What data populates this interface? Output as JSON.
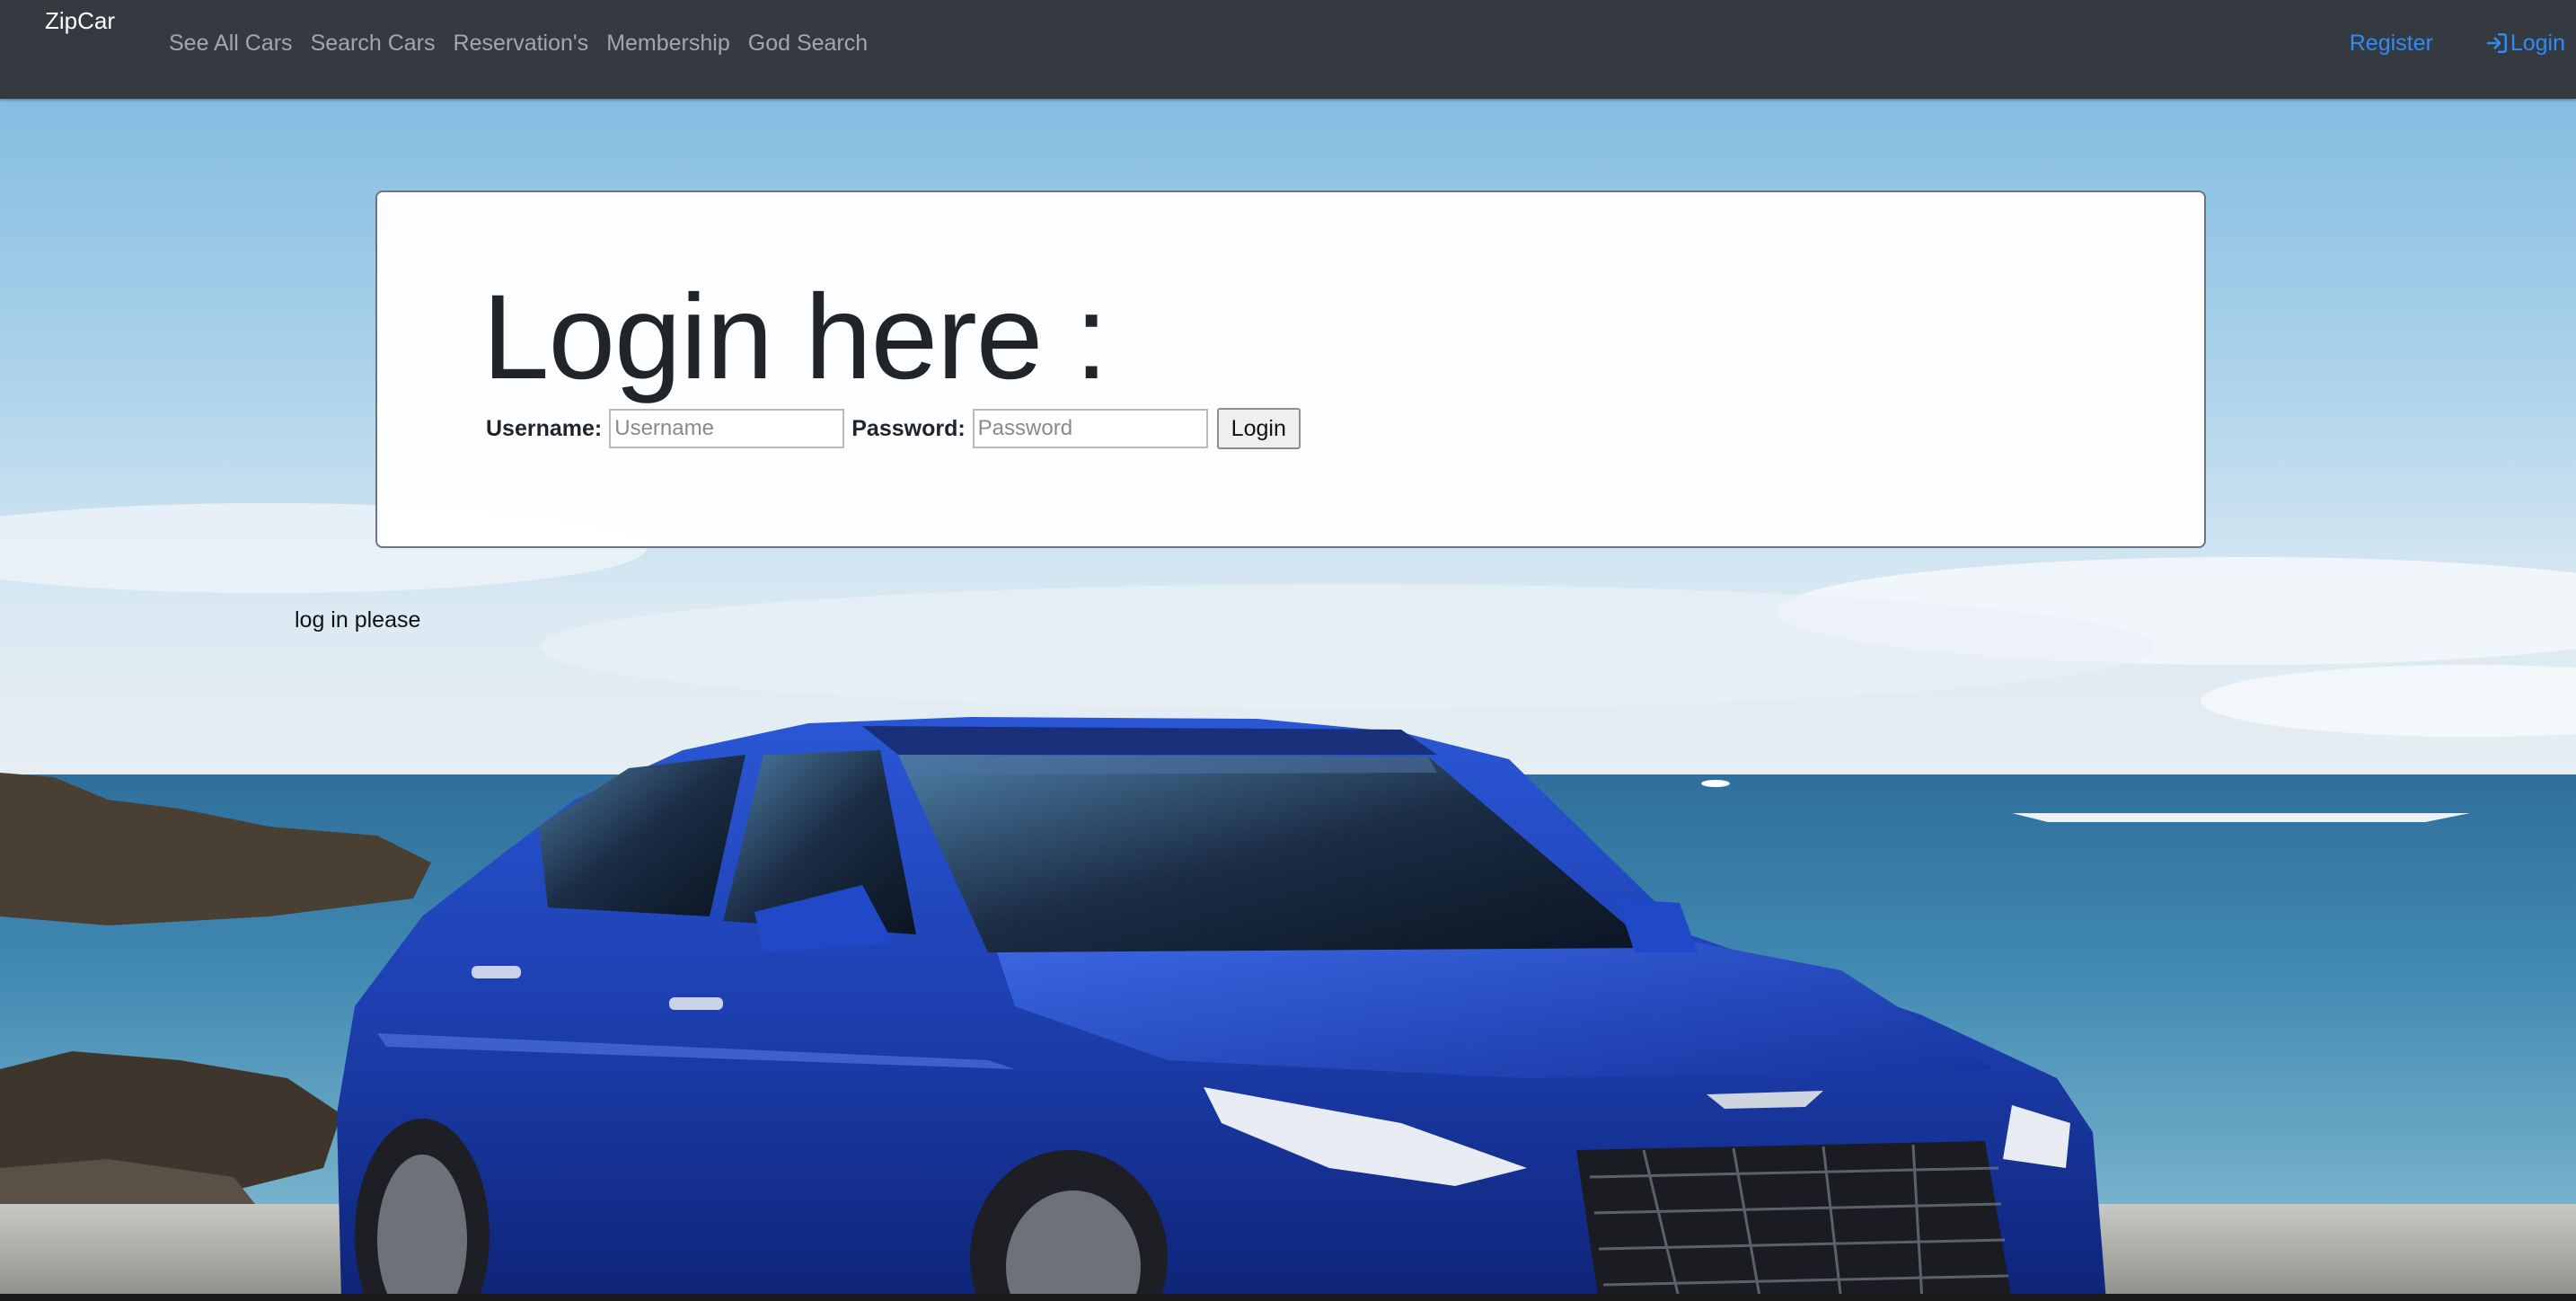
{
  "navbar": {
    "brand": "ZipCar",
    "links": [
      {
        "label": "See All Cars"
      },
      {
        "label": "Search Cars"
      },
      {
        "label": "Reservation's"
      },
      {
        "label": "Membership"
      },
      {
        "label": "God Search"
      }
    ],
    "register_label": "Register",
    "login_label": "Login",
    "login_icon": "sign-in-icon",
    "bg_color": "#343a40",
    "link_color": "#2f8bf5"
  },
  "login_card": {
    "title": "Login here :",
    "username_label": "Username:",
    "username_value": "",
    "username_placeholder": "Username",
    "password_label": "Password:",
    "password_value": "",
    "password_placeholder": "Password",
    "submit_label": "Login"
  },
  "status_message": "log in please",
  "background": {
    "description_icon": "blue-sedan-on-beach-image",
    "car_color": "#1f44b8",
    "sea_color": "#3f86b0",
    "sky_color": "#8fc3e0"
  }
}
